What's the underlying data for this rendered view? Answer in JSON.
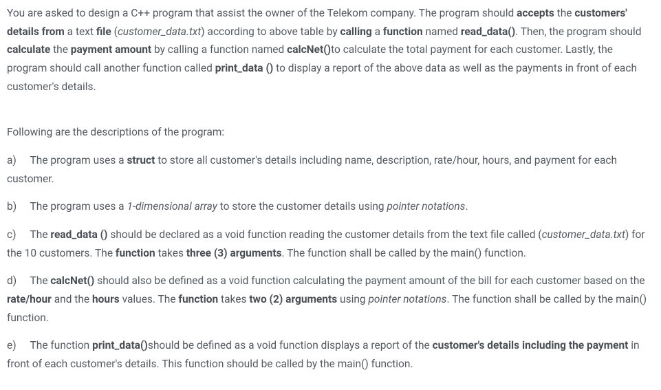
{
  "intro": {
    "p1_seg1": "You are asked to design a C++ program that assist the owner of the Telekom company. The program should ",
    "p1_b1": "accepts",
    "p1_seg2": " the ",
    "p1_b2": "customers' details from",
    "p1_seg3": " a text ",
    "p1_b3": "file",
    "p1_seg4": " (",
    "p1_i1": "customer_data.txt",
    "p1_seg5": ") according to above table by ",
    "p1_b4": "calling",
    "p1_seg6": " a ",
    "p1_b5": "function",
    "p1_seg7": " named ",
    "p1_b6": "read_data()",
    "p1_seg8": ". Then, the program should ",
    "p1_b7": "calculate",
    "p1_seg9": " the ",
    "p1_b8": "payment amount",
    "p1_seg10": " by calling a function named ",
    "p1_b9": "calcNet()",
    "p1_seg11": "to calculate the total payment for each customer. Lastly, the program should call another function called ",
    "p1_b10": "print_data ()",
    "p1_seg12": " to display a report of the above data as well as the payments in front of each customer's details."
  },
  "lead": "Following are the descriptions of the program:",
  "items": {
    "a": {
      "label": "a)",
      "seg1": "The program uses a ",
      "b1": "struct",
      "seg2": " to store all customer's details including name, description, rate/hour, hours, and payment for each customer."
    },
    "b": {
      "label": "b)",
      "seg1": "The program uses a ",
      "i1": "1-dimensional array",
      "seg2": " to store the customer details using ",
      "i2": "pointer notations",
      "seg3": "."
    },
    "c": {
      "label": "c)",
      "seg1": "The ",
      "b1": "read_data ()",
      "seg2": " should be declared as a void function reading the customer details from the text file called (",
      "i1": "customer_data.txt",
      "seg3": ") for the 10 customers. The ",
      "b2": "function",
      "seg4": " takes ",
      "b3": "three (3) arguments",
      "seg5": ". The function shall be called by the main() function."
    },
    "d": {
      "label": "d)",
      "seg1": "The ",
      "b1": "calcNet()",
      "seg2": " should also be defined as a void function calculating the payment amount of the bill for each customer based on the ",
      "b2": "rate/hour",
      "seg3": " and the ",
      "b3": "hours",
      "seg4": " values. The ",
      "b4": "function",
      "seg5": " takes ",
      "b5": "two (2) arguments",
      "seg6": " using ",
      "i1": "pointer notations",
      "seg7": ". The function shall be called by the main() function."
    },
    "e": {
      "label": "e)",
      "seg1": "The function ",
      "b1": "print_data()",
      "seg2": "should be defined as a void function displays a report of the ",
      "b2": "customer's details including the payment",
      "seg3": " in front of each customer's details. This function should be called by the main() function."
    }
  }
}
